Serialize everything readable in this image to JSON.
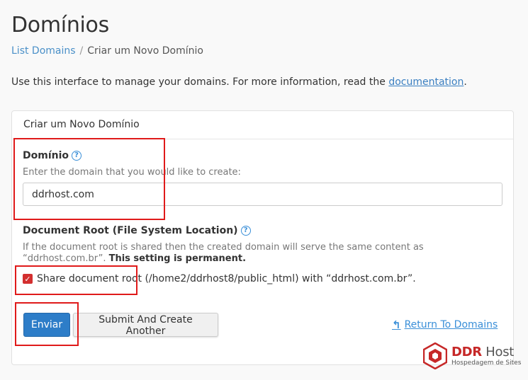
{
  "page": {
    "title": "Domínios",
    "breadcrumb": {
      "link": "List Domains",
      "separator": "/",
      "current": "Criar um Novo Domínio"
    },
    "intro": {
      "text": "Use this interface to manage your domains. For more information, read the ",
      "link": "documentation",
      "end": "."
    }
  },
  "panel": {
    "heading": "Criar um Novo Domínio",
    "domain": {
      "label": "Domínio",
      "hint": "Enter the domain that you would like to create:",
      "value": "ddrhost.com"
    },
    "docroot": {
      "label": "Document Root (File System Location)",
      "hint": "If the document root is shared then the created domain will serve the same content as “ddrhost.com.br”. ",
      "hint_bold": "This setting is permanent.",
      "share_label": "Share document root (/home2/ddrhost8/public_html) with “ddrhost.com.br”.",
      "share_checked": true
    },
    "buttons": {
      "submit": "Enviar",
      "submit_another": "Submit And Create Another",
      "return": "Return To Domains"
    }
  },
  "brand": {
    "name": "DDR",
    "name_suffix": " Host",
    "subtitle": "Hospedagem de Sites"
  },
  "colors": {
    "primary": "#2d7dc8",
    "link": "#3a8fd8",
    "highlight": "#e01a1a",
    "brand": "#c62828"
  }
}
